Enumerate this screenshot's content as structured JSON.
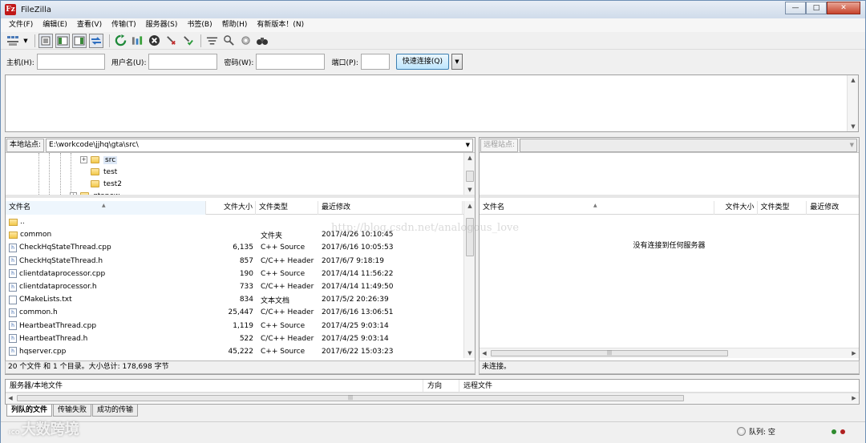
{
  "window": {
    "title": "FileZilla",
    "app_icon": "Fz",
    "minimize_glyph": "—",
    "maximize_glyph": "□",
    "close_glyph": "✕"
  },
  "menu": [
    "文件(F)",
    "编辑(E)",
    "查看(V)",
    "传输(T)",
    "服务器(S)",
    "书签(B)",
    "帮助(H)",
    "有新版本！(N)"
  ],
  "toolbar": {
    "icons": [
      "site-manager-icon",
      "dropdown-arrow-icon",
      "toggle-log-icon",
      "toggle-local-tree-icon",
      "toggle-remote-tree-icon",
      "toggle-queue-icon",
      "refresh-icon",
      "process-queue-icon",
      "cancel-icon",
      "disconnect-icon",
      "reconnect-icon",
      "filter-icon",
      "compare-icon",
      "sync-browse-icon",
      "search-icon"
    ]
  },
  "quickconnect": {
    "host_label": "主机(H):",
    "user_label": "用户名(U):",
    "pass_label": "密码(W):",
    "port_label": "端口(P):",
    "host_value": "",
    "user_value": "",
    "pass_value": "",
    "port_value": "",
    "connect_label": "快速连接(Q)",
    "dropdown_glyph": "▼"
  },
  "local": {
    "site_label": "本地站点:",
    "path": "E:\\workcode\\jjhq\\gta\\src\\",
    "tree": [
      {
        "name": "src",
        "expander": "+",
        "selected": true
      },
      {
        "name": "test"
      },
      {
        "name": "test2"
      },
      {
        "name": "gtanew",
        "expander": "+",
        "partial": true
      }
    ],
    "columns": [
      "文件名",
      "文件大小",
      "文件类型",
      "最近修改"
    ],
    "files": [
      {
        "name": "..",
        "size": "",
        "type": "",
        "modified": "",
        "kind": "folder"
      },
      {
        "name": "common",
        "size": "",
        "type": "文件夹",
        "modified": "2017/4/26 10:10:45",
        "kind": "folder"
      },
      {
        "name": "CheckHqStateThread.cpp",
        "size": "6,135",
        "type": "C++ Source",
        "modified": "2017/6/16 10:05:53",
        "kind": "cpp"
      },
      {
        "name": "CheckHqStateThread.h",
        "size": "857",
        "type": "C/C++ Header",
        "modified": "2017/6/7 9:18:19",
        "kind": "h"
      },
      {
        "name": "clientdataprocessor.cpp",
        "size": "190",
        "type": "C++ Source",
        "modified": "2017/4/14 11:56:22",
        "kind": "cpp"
      },
      {
        "name": "clientdataprocessor.h",
        "size": "733",
        "type": "C/C++ Header",
        "modified": "2017/4/14 11:49:50",
        "kind": "h"
      },
      {
        "name": "CMakeLists.txt",
        "size": "834",
        "type": "文本文档",
        "modified": "2017/5/2 20:26:39",
        "kind": "txt"
      },
      {
        "name": "common.h",
        "size": "25,447",
        "type": "C/C++ Header",
        "modified": "2017/6/16 13:06:51",
        "kind": "h"
      },
      {
        "name": "HeartbeatThread.cpp",
        "size": "1,119",
        "type": "C++ Source",
        "modified": "2017/4/25 9:03:14",
        "kind": "cpp"
      },
      {
        "name": "HeartbeatThread.h",
        "size": "522",
        "type": "C/C++ Header",
        "modified": "2017/4/25 9:03:14",
        "kind": "h"
      },
      {
        "name": "hqserver.cpp",
        "size": "45,222",
        "type": "C++ Source",
        "modified": "2017/6/22 15:03:23",
        "kind": "cpp"
      }
    ],
    "status": "20 个文件 和 1 个目录。大小总计: 178,698 字节"
  },
  "remote": {
    "site_label": "远程站点:",
    "path": "",
    "columns": [
      "文件名",
      "文件大小",
      "文件类型",
      "最近修改"
    ],
    "empty_message": "没有连接到任何服务器",
    "status": "未连接。"
  },
  "watermark": "http://blog.csdn.net/analogous_love",
  "queue": {
    "columns": [
      "服务器/本地文件",
      "方向",
      "远程文件"
    ],
    "tabs": [
      "列队的文件",
      "传输失败",
      "成功的传输"
    ],
    "status": "队列: 空"
  },
  "brand": {
    "prefix": "ICO",
    "name": "大数跨境"
  },
  "colors": {
    "led_green": "#2e8b2e",
    "led_red": "#b02020",
    "accent": "#3c7fb1"
  }
}
